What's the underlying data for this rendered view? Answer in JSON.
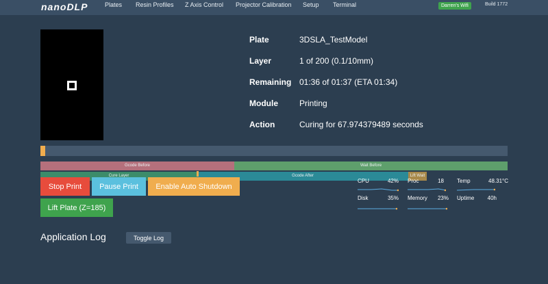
{
  "navbar": {
    "brand": "nanoDLP",
    "links": [
      "Plates",
      "Resin Profiles",
      "Z Axis Control",
      "Projector Calibration",
      "Setup",
      "Terminal"
    ],
    "wifi_badge": "Darren's Wifi",
    "build": "Build 1772"
  },
  "status": {
    "rows": [
      {
        "label": "Plate",
        "value": "3DSLA_TestModel"
      },
      {
        "label": "Layer",
        "value": "1 of 200 (0.1/10mm)"
      },
      {
        "label": "Remaining",
        "value": "01:36 of 01:37 (ETA 01:34)"
      },
      {
        "label": "Module",
        "value": "Printing"
      },
      {
        "label": "Action",
        "value": "Curing for 67.974379489 seconds"
      }
    ]
  },
  "progress": {
    "fraction": 0.01
  },
  "timeline": {
    "gcode_before": "Gcode Before",
    "wait_before": "Wait Before",
    "cure_layer": "Cure Layer",
    "gcode_after": "Gcode After",
    "lift_wait": "Lift Wait"
  },
  "buttons": {
    "stop": "Stop Print",
    "pause": "Pause Print",
    "auto_shutdown": "Enable Auto Shutdown",
    "lift_plate": "Lift Plate (Z=185)"
  },
  "stats": {
    "cpu_label": "CPU",
    "cpu_value": "42%",
    "proc_label": "Proc",
    "proc_value": "18",
    "temp_label": "Temp",
    "temp_value": "48.31°C",
    "disk_label": "Disk",
    "disk_value": "35%",
    "memory_label": "Memory",
    "memory_value": "23%",
    "uptime_label": "Uptime",
    "uptime_value": "40h"
  },
  "log": {
    "title": "Application Log",
    "toggle": "Toggle Log"
  },
  "colors": {
    "background": "#2c3e50",
    "navbar": "#3a4f65",
    "progress": "#f0ad4e",
    "gcode_before": "#b5707c",
    "wait_before": "#5e9f6c",
    "cure_layer": "#3c8c6a",
    "gcode_after": "#2b8a97",
    "lift_wait": "#a8894a",
    "sparkline": "#5dade2",
    "danger": "#e74c3c",
    "info": "#5bc0de",
    "warning": "#f0ad4e",
    "success": "#3fa34d"
  },
  "icons": {
    "preview_marker": "square-outline-icon"
  }
}
